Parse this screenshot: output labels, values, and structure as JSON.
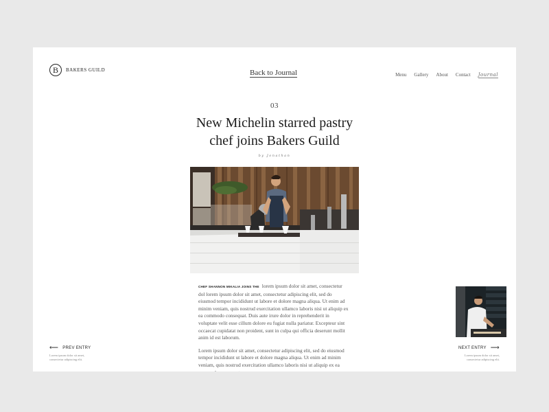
{
  "brand": {
    "initial": "B",
    "name": "BAKERS GUILD"
  },
  "header": {
    "back_link": "Back to Journal",
    "nav": [
      "Menu",
      "Gallery",
      "About",
      "Contact",
      "Journal"
    ]
  },
  "article": {
    "number": "03",
    "title_line1": "New Michelin starred pastry",
    "title_line2": "chef joins Bakers Guild",
    "byline": "by Jonathan",
    "lead_in": "CHEF SHANNON MIKALIA JOINS THE",
    "paragraph1": "lorem ipsum dolor sit amet, consectetur dol lorem ipsum dolor sit amet, consectetur adipiscing elit, sed do eiusmod tempor incididunt ut labore et dolore magna aliqua. Ut enim ad minim veniam, quis nostrud exercitation ullamco laboris nisi ut aliquip ex ea commodo consequat. Duis aute irure dolor in reprehenderit in voluptate velit esse cillum dolore eu fugiat nulla pariatur. Excepteur sint occaecat cupidatat non proident, sunt in culpa qui officia deserunt mollit anim id est laborum.",
    "paragraph2": "Lorem ipsum dolor sit amet, consectetur adipiscing elit, sed do eiusmod tempor incididunt ut labore et dolore magna aliqua. Ut enim ad minim veniam, quis nostrud exercitation ullamco laboris nisi ut aliquip ex ea commodo consequat."
  },
  "prev_entry": {
    "label": "PREV ENTRY",
    "blurb_line1": "Lorem ipsum dolor sit amet,",
    "blurb_line2": "consectetur adipiscing elit."
  },
  "next_entry": {
    "label": "NEXT ENTRY",
    "blurb_line1": "Lorem ipsum dolor sit amet,",
    "blurb_line2": "consectetur adipiscing elit."
  },
  "icons": {
    "prev": "arrow-left-icon",
    "next": "arrow-right-icon"
  }
}
